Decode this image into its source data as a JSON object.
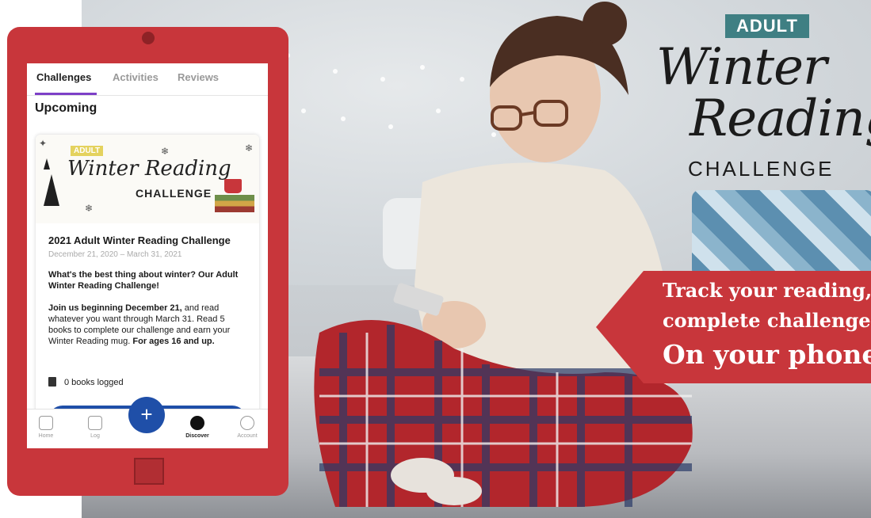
{
  "colors": {
    "tablet_red": "#c8363b",
    "accent_blue": "#1f4fa8",
    "tab_purple": "#7d3fc7",
    "adult_teal": "#3f7f83"
  },
  "hero": {
    "adult_tag": "ADULT",
    "title_line1": "Winter",
    "title_line2": "Reading",
    "title_line3": "CHALLENGE"
  },
  "callout": {
    "line1": "Track your reading,",
    "line2": "complete challenges.",
    "line3": "On your phone!"
  },
  "app": {
    "tabs": [
      {
        "label": "Challenges",
        "active": true
      },
      {
        "label": "Activities",
        "active": false
      },
      {
        "label": "Reviews",
        "active": false
      }
    ],
    "section_heading": "Upcoming",
    "card": {
      "banner_adult": "ADULT",
      "banner_title": "Winter Reading",
      "banner_challenge": "CHALLENGE",
      "title": "2021 Adult Winter Reading Challenge",
      "dates": "December 21, 2020 – March 31, 2021",
      "question": "What's the best thing about winter? Our Adult Winter Reading Challenge!",
      "body_bold_start": "Join us beginning December 21,",
      "body_middle": " and read whatever you want through March 31. Read 5 books to complete our challenge and earn your Winter Reading mug. ",
      "body_bold_end": "For ages 16 and up.",
      "books_logged": "0 books logged"
    },
    "nav": [
      {
        "label": "Home",
        "icon": "home-icon"
      },
      {
        "label": "Log",
        "icon": "log-icon"
      },
      {
        "label": "Discover",
        "icon": "compass-icon",
        "active": true
      },
      {
        "label": "Account",
        "icon": "gear-icon"
      }
    ],
    "fab_label": "+"
  }
}
